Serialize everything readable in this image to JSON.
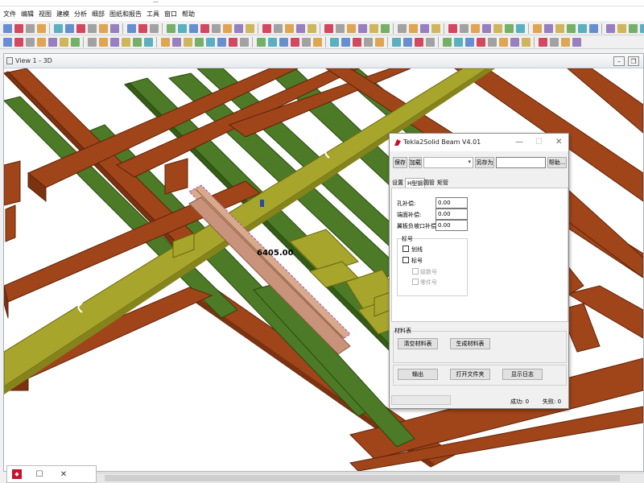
{
  "menu": [
    "文件",
    "编辑",
    "视图",
    "建模",
    "分析",
    "细部",
    "图纸和报告",
    "工具",
    "窗口",
    "帮助"
  ],
  "view": {
    "title": "View 1 - 3D",
    "dimension_label": "6405.00"
  },
  "colors": {
    "beam_brown": "#a0441a",
    "beam_green": "#4d7a26",
    "beam_yellow": "#a7a52c",
    "selection": "#d9a98c"
  },
  "dialog": {
    "title": "Tekla2Solid Beam V4.01",
    "save": "保存",
    "load": "加载",
    "save_as": "另存为",
    "help": "帮助...",
    "tabs": [
      "设置",
      "H型钢",
      "圆管",
      "矩管"
    ],
    "fields": [
      {
        "label": "孔补偿:",
        "value": "0.00"
      },
      {
        "label": "端面补偿:",
        "value": "0.00"
      },
      {
        "label": "翼板负坡口补偿:",
        "value": "0.00"
      }
    ],
    "mark_group": "标号",
    "mark_options": [
      "划线",
      "标号"
    ],
    "mark_sub_options": [
      "级数号",
      "零件号"
    ],
    "material_group": "材料表",
    "clear_material": "清空材料表",
    "gen_material": "生成材料表",
    "output": "输出",
    "open_folder": "打开文件夹",
    "show_log": "显示日志",
    "success_label": "成功: 0",
    "fail_label": "失败: 0"
  }
}
